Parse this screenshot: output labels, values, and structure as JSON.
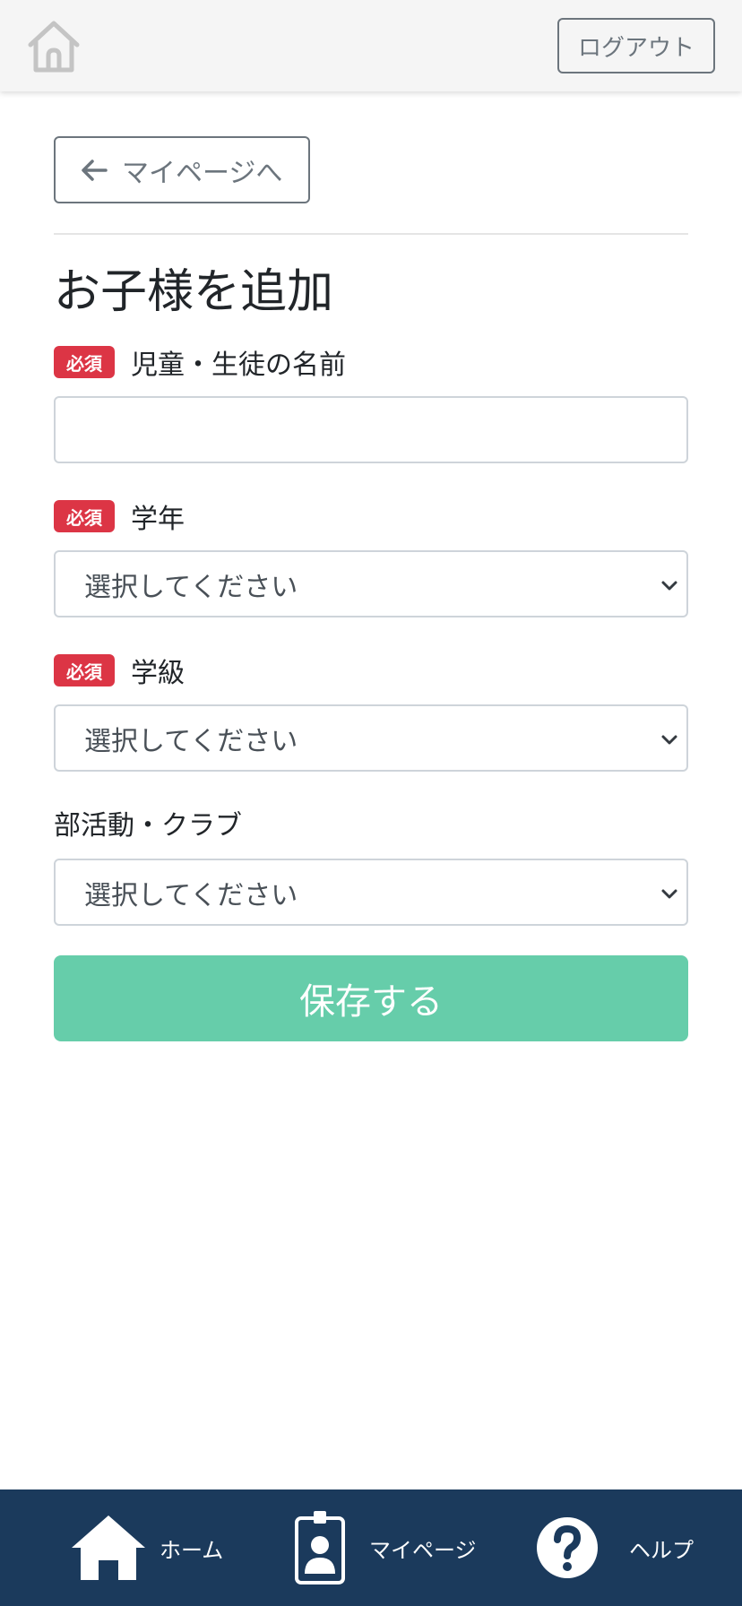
{
  "header": {
    "logout_label": "ログアウト"
  },
  "back": {
    "label": "マイページへ"
  },
  "form": {
    "title": "お子様を追加",
    "required_badge": "必須",
    "name_label": "児童・生徒の名前",
    "name_value": "",
    "grade_label": "学年",
    "grade_value": "選択してください",
    "class_label": "学級",
    "class_value": "選択してください",
    "club_label": "部活動・クラブ",
    "club_value": "選択してください",
    "save_label": "保存する"
  },
  "nav": {
    "home_label": "ホーム",
    "mypage_label": "マイページ",
    "help_label": "ヘルプ"
  },
  "colors": {
    "required": "#dc3545",
    "save": "#66cdaa",
    "nav_bg": "#1b3a5c"
  }
}
